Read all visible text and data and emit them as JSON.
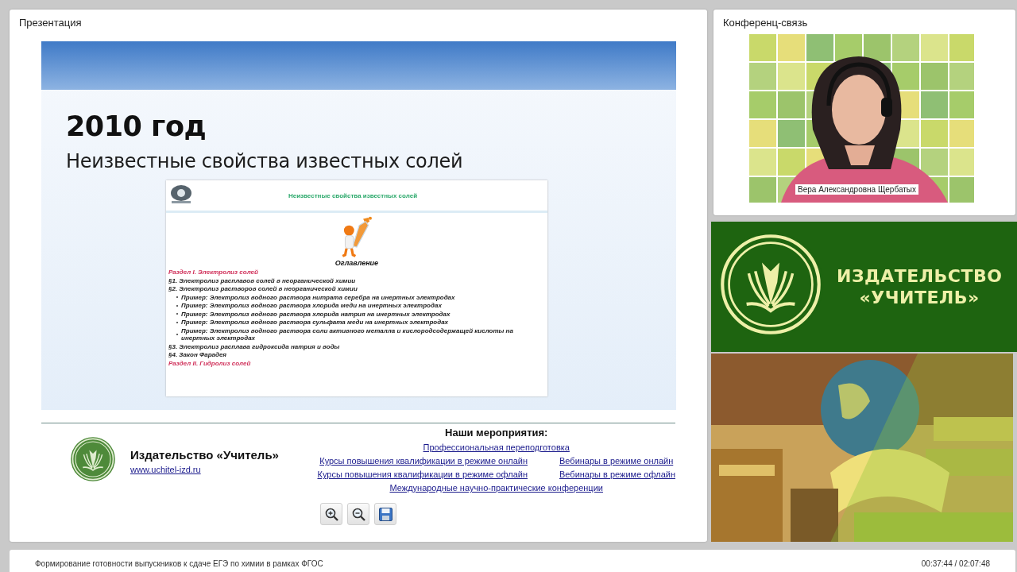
{
  "presentation": {
    "title": "Презентация",
    "slide": {
      "heading": "2010 год",
      "subheading": "Неизвестные свойства известных солей",
      "embedded_page": {
        "site_title": "Неизвестные свойства известных солей",
        "toc_title": "Оглавление",
        "toc": [
          {
            "kind": "section",
            "text": "Раздел I. Электролиз солей"
          },
          {
            "kind": "paragraph",
            "text": "§1. Электролиз расплавов солей в неорганической химии"
          },
          {
            "kind": "paragraph",
            "text": "§2. Электролиз растворов солей в неорганической химии"
          },
          {
            "kind": "example",
            "text": "Пример: Электролиз водного раствора нитрата серебра на инертных электродах"
          },
          {
            "kind": "example",
            "text": "Пример: Электролиз водного раствора хлорида меди на инертных электродах"
          },
          {
            "kind": "example",
            "text": "Пример: Электролиз водного раствора хлорида натрия на инертных электродах"
          },
          {
            "kind": "example",
            "text": "Пример: Электролиз водного раствора сульфата меди на инертных электродах"
          },
          {
            "kind": "example",
            "text": "Пример: Электролиз водного раствора соли активного металла и кислородсодержащей кислоты на инертных электродах"
          },
          {
            "kind": "paragraph",
            "text": "§3. Электролиз расплава гидроксида натрия и воды"
          },
          {
            "kind": "paragraph",
            "text": "§4. Закон Фарадея"
          },
          {
            "kind": "section",
            "text": "Раздел II. Гидролиз солей"
          }
        ]
      },
      "footer": {
        "publisher": "Издательство «Учитель»",
        "website": "www.uchitel-izd.ru",
        "events_title": "Наши мероприятия:",
        "events": [
          [
            "Профессиональная переподготовка"
          ],
          [
            "Курсы повышения квалификации в режиме онлайн",
            "Вебинары в режиме онлайн"
          ],
          [
            "Курсы повышения квалификации в режиме офлайн",
            "Вебинары в режиме офлайн"
          ],
          [
            "Международные научно-практические конференции"
          ]
        ]
      }
    },
    "toolbar": [
      {
        "kind": "zoom-in"
      },
      {
        "kind": "zoom-out"
      },
      {
        "kind": "save"
      }
    ]
  },
  "conference": {
    "title": "Конференц-связь",
    "speaker_name": "Вера Александровна Щербатых"
  },
  "banner": {
    "lines": [
      "ИЗДАТЕЛЬСТВО",
      "«УЧИТЕЛЬ»"
    ]
  },
  "status_bar": {
    "title": "Формирование готовности выпускников к сдаче ЕГЭ по химии в рамках ФГОС",
    "time": "00:37:44 / 02:07:48"
  }
}
